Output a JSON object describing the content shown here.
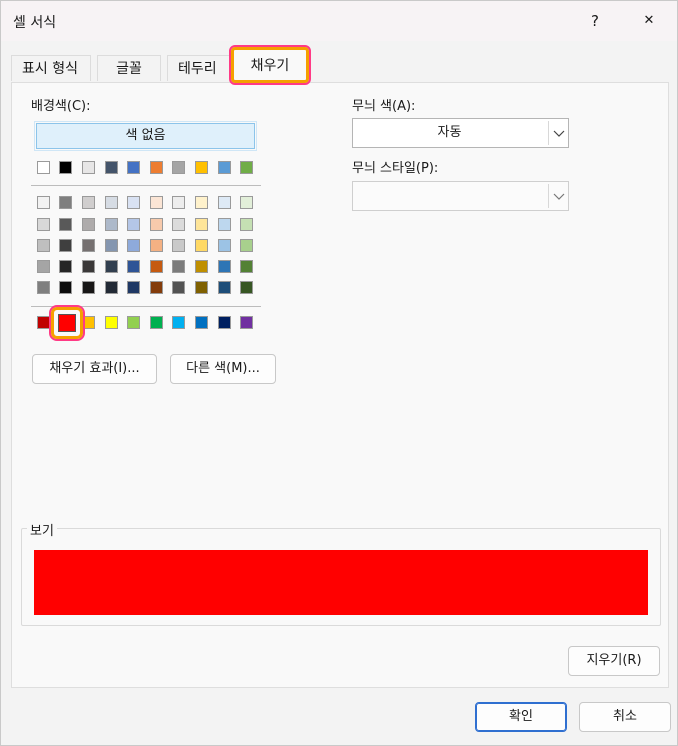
{
  "window": {
    "title": "셀 서식",
    "help_glyph": "?",
    "close_glyph": "✕"
  },
  "tabs": [
    {
      "label": "표시 형식",
      "active": false
    },
    {
      "label": "글꼴",
      "active": false
    },
    {
      "label": "테두리",
      "active": false
    },
    {
      "label": "채우기",
      "active": true
    }
  ],
  "fill": {
    "background_label": "배경색(C):",
    "no_color_label": "색 없음",
    "theme_row": [
      "#ffffff",
      "#000000",
      "#e7e6e6",
      "#44546a",
      "#4472c4",
      "#ed7d31",
      "#a5a5a5",
      "#ffc000",
      "#5b9bd5",
      "#70ad47"
    ],
    "tint_rows": [
      [
        "#f2f2f2",
        "#7f7f7f",
        "#d0cece",
        "#d6dce4",
        "#d9e2f3",
        "#fbe5d5",
        "#ededed",
        "#fff2cc",
        "#deeaf6",
        "#e2efd9"
      ],
      [
        "#d8d8d8",
        "#595959",
        "#aeabab",
        "#adb9ca",
        "#b4c6e7",
        "#f7caac",
        "#dbdbdb",
        "#fee599",
        "#bdd7ee",
        "#c5e0b3"
      ],
      [
        "#bfbfbf",
        "#3f3f3f",
        "#757070",
        "#8496b0",
        "#8eaadb",
        "#f4b183",
        "#c9c9c9",
        "#ffd965",
        "#9cc3e5",
        "#a8d08d"
      ],
      [
        "#a5a5a5",
        "#262626",
        "#3a3838",
        "#323f4f",
        "#2f5496",
        "#c55a11",
        "#7b7b7b",
        "#bf8f00",
        "#2e75b5",
        "#538135"
      ],
      [
        "#7f7f7f",
        "#0c0c0c",
        "#171616",
        "#222a35",
        "#1f3864",
        "#833c0b",
        "#525252",
        "#7f6000",
        "#1e4e79",
        "#375623"
      ]
    ],
    "standard_row": [
      "#c00000",
      "#ff0000",
      "#ffc000",
      "#ffff00",
      "#92d050",
      "#00b050",
      "#00b0f0",
      "#0070c0",
      "#002060",
      "#7030a0"
    ],
    "selected_color": "#ff0000",
    "fill_effects_label": "채우기 효과(I)...",
    "more_colors_label": "다른 색(M)..."
  },
  "pattern": {
    "color_label": "무늬 색(A):",
    "color_value": "자동",
    "style_label": "무늬 스타일(P):",
    "style_value": ""
  },
  "sample": {
    "title": "보기",
    "color": "#ff0000"
  },
  "buttons": {
    "clear_label": "지우기(R)",
    "ok_label": "확인",
    "cancel_label": "취소"
  }
}
